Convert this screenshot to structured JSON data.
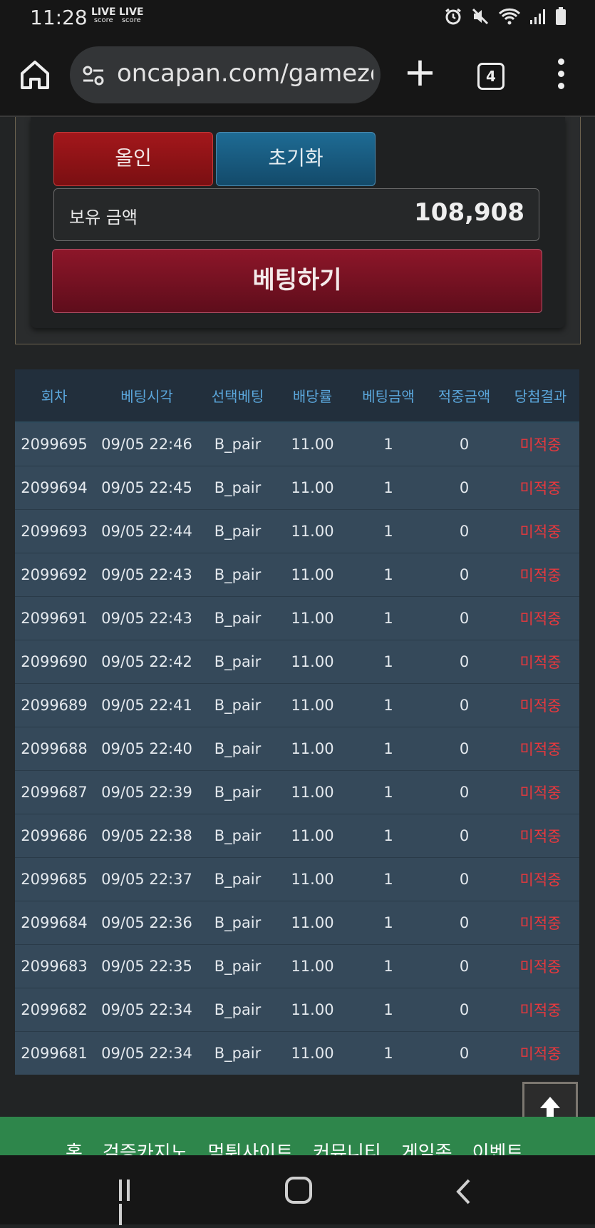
{
  "status_bar": {
    "time": "11:28",
    "live_badges": [
      {
        "top": "LIVE",
        "bottom": "score"
      },
      {
        "top": "LIVE",
        "bottom": "score"
      }
    ],
    "icons": [
      "alarm-icon",
      "mute-icon",
      "wifi-icon",
      "signal-icon",
      "battery-icon"
    ]
  },
  "browser": {
    "url": "oncapan.com/gamezo",
    "tab_count": "4",
    "plus_label": "+"
  },
  "controls": {
    "allin_label": "올인",
    "reset_label": "초기화",
    "balance_label": "보유 금액",
    "balance_value": "108,908",
    "bet_label": "베팅하기"
  },
  "table": {
    "headers": [
      "회차",
      "베팅시각",
      "선택베팅",
      "배당률",
      "베팅금액",
      "적중금액",
      "당첨결과"
    ],
    "rows": [
      [
        "2099695",
        "09/05 22:46",
        "B_pair",
        "11.00",
        "1",
        "0",
        "미적중"
      ],
      [
        "2099694",
        "09/05 22:45",
        "B_pair",
        "11.00",
        "1",
        "0",
        "미적중"
      ],
      [
        "2099693",
        "09/05 22:44",
        "B_pair",
        "11.00",
        "1",
        "0",
        "미적중"
      ],
      [
        "2099692",
        "09/05 22:43",
        "B_pair",
        "11.00",
        "1",
        "0",
        "미적중"
      ],
      [
        "2099691",
        "09/05 22:43",
        "B_pair",
        "11.00",
        "1",
        "0",
        "미적중"
      ],
      [
        "2099690",
        "09/05 22:42",
        "B_pair",
        "11.00",
        "1",
        "0",
        "미적중"
      ],
      [
        "2099689",
        "09/05 22:41",
        "B_pair",
        "11.00",
        "1",
        "0",
        "미적중"
      ],
      [
        "2099688",
        "09/05 22:40",
        "B_pair",
        "11.00",
        "1",
        "0",
        "미적중"
      ],
      [
        "2099687",
        "09/05 22:39",
        "B_pair",
        "11.00",
        "1",
        "0",
        "미적중"
      ],
      [
        "2099686",
        "09/05 22:38",
        "B_pair",
        "11.00",
        "1",
        "0",
        "미적중"
      ],
      [
        "2099685",
        "09/05 22:37",
        "B_pair",
        "11.00",
        "1",
        "0",
        "미적중"
      ],
      [
        "2099684",
        "09/05 22:36",
        "B_pair",
        "11.00",
        "1",
        "0",
        "미적중"
      ],
      [
        "2099683",
        "09/05 22:35",
        "B_pair",
        "11.00",
        "1",
        "0",
        "미적중"
      ],
      [
        "2099682",
        "09/05 22:34",
        "B_pair",
        "11.00",
        "1",
        "0",
        "미적중"
      ],
      [
        "2099681",
        "09/05 22:34",
        "B_pair",
        "11.00",
        "1",
        "0",
        "미적중"
      ]
    ]
  },
  "footer_nav": [
    "홈",
    "검증카지노",
    "먹튀사이트",
    "커뮤니티",
    "게임존",
    "이벤트"
  ],
  "colors": {
    "header_text": "#5ba7dc",
    "result_text": "#e8383d",
    "footer_bg": "#2e864b"
  }
}
